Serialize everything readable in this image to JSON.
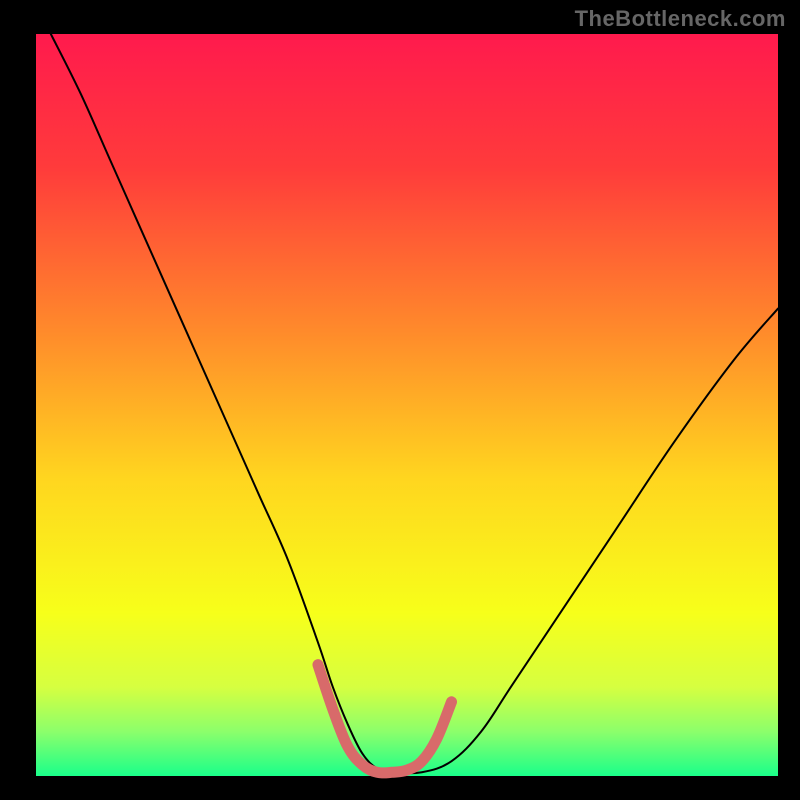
{
  "watermark": "TheBottleneck.com",
  "chart_data": {
    "type": "line",
    "title": "",
    "xlabel": "",
    "ylabel": "",
    "xlim": [
      0,
      100
    ],
    "ylim": [
      0,
      100
    ],
    "grid": false,
    "legend": false,
    "background_gradient_stops": [
      {
        "offset": 0.0,
        "color": "#ff1a4d"
      },
      {
        "offset": 0.18,
        "color": "#ff3b3b"
      },
      {
        "offset": 0.4,
        "color": "#ff8a2b"
      },
      {
        "offset": 0.6,
        "color": "#ffd61f"
      },
      {
        "offset": 0.78,
        "color": "#f7ff1a"
      },
      {
        "offset": 0.88,
        "color": "#d6ff40"
      },
      {
        "offset": 0.94,
        "color": "#8cff6b"
      },
      {
        "offset": 1.0,
        "color": "#1aff8a"
      }
    ],
    "series": [
      {
        "name": "bottleneck-curve",
        "color": "#000000",
        "stroke_width": 2,
        "x": [
          2,
          6,
          10,
          14,
          18,
          22,
          26,
          30,
          34,
          38,
          40,
          42,
          44,
          46,
          48,
          52,
          56,
          60,
          64,
          70,
          78,
          86,
          94,
          100
        ],
        "y": [
          100,
          92,
          83,
          74,
          65,
          56,
          47,
          38,
          29,
          18,
          12,
          7,
          3,
          1,
          0.5,
          0.5,
          2,
          6,
          12,
          21,
          33,
          45,
          56,
          63
        ]
      },
      {
        "name": "sweet-spot-marker",
        "color": "#d86a6a",
        "stroke_width": 11,
        "x": [
          38,
          40,
          42,
          44,
          46,
          48,
          50,
          52,
          54,
          56
        ],
        "y": [
          15,
          9,
          4,
          1.5,
          0.5,
          0.5,
          0.8,
          2,
          5,
          10
        ]
      }
    ]
  },
  "plot_geometry": {
    "outer_w": 800,
    "outer_h": 800,
    "inner_x": 36,
    "inner_y": 34,
    "inner_w": 742,
    "inner_h": 742
  }
}
